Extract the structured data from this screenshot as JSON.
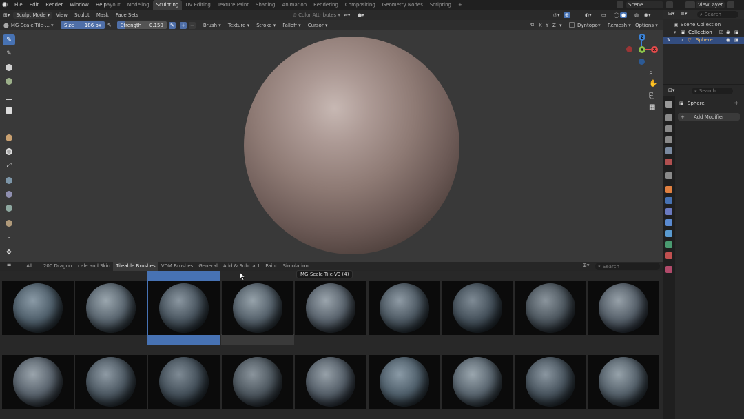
{
  "menubar": {
    "menus": [
      "File",
      "Edit",
      "Render",
      "Window",
      "Help"
    ],
    "workspaces": [
      "Layout",
      "Modeling",
      "Sculpting",
      "UV Editing",
      "Texture Paint",
      "Shading",
      "Animation",
      "Rendering",
      "Compositing",
      "Geometry Nodes",
      "Scripting"
    ],
    "active_workspace": "Sculpting",
    "scene": "Scene",
    "view_layer": "ViewLayer"
  },
  "header": {
    "mode": "Sculpt Mode",
    "items": [
      "View",
      "Sculpt",
      "Mask",
      "Face Sets"
    ],
    "color_attributes": "Color Attributes"
  },
  "tool_settings": {
    "brush_name": "MG-Scale-Tile-...",
    "size_label": "Size",
    "size_value": "186 px",
    "strength_label": "Strength",
    "strength_value": "0.150",
    "strength_fraction": 0.15,
    "menus": [
      "Brush",
      "Texture",
      "Stroke",
      "Falloff",
      "Cursor"
    ],
    "axes": [
      "X",
      "Y",
      "Z"
    ],
    "dyntopo": "Dyntopo",
    "remesh": "Remesh",
    "options": "Options"
  },
  "gizmo": {
    "x": "X",
    "y": "Y",
    "z": "Z"
  },
  "asset_shelf": {
    "tabs": [
      "All",
      "200 Dragon ...cale and Skin",
      "Tileable Brushes",
      "VDM Brushes",
      "General",
      "Add & Subtract",
      "Paint",
      "Simulation"
    ],
    "active_tab": "Tileable Brushes",
    "search_placeholder": "Search",
    "tooltip": "MG-Scale-Tile-V3 (4)",
    "selected_index": 2
  },
  "outliner": {
    "search_placeholder": "Search",
    "scene_collection": "Scene Collection",
    "collection": "Collection",
    "object": "Sphere"
  },
  "properties": {
    "search_placeholder": "Search",
    "object_name": "Sphere",
    "add_modifier": "Add Modifier"
  },
  "colors": {
    "accent": "#4772b3",
    "gizmo_x": "#e44b4b",
    "gizmo_y": "#8bc34a",
    "gizmo_z": "#3b82d6"
  }
}
